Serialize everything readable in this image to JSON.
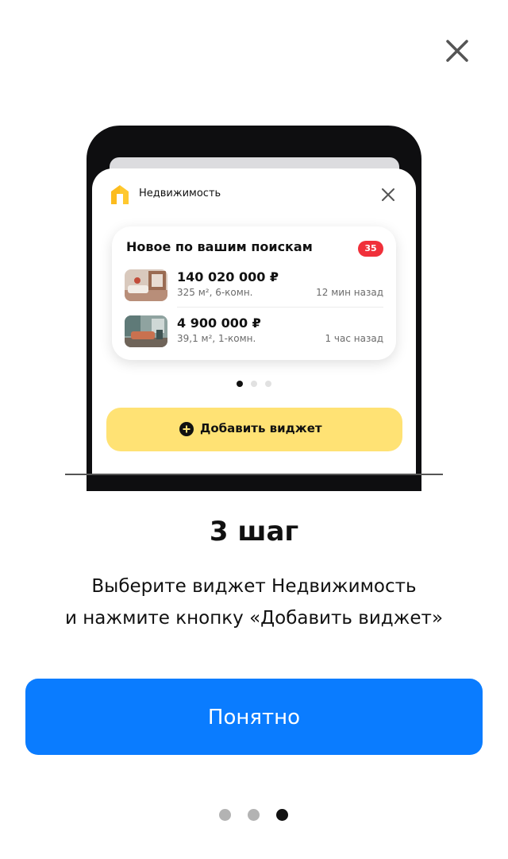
{
  "dialog": {
    "close_icon": "close-icon",
    "step_title": "3 шаг",
    "description_lines": [
      "Выберите виджет Недвижимость",
      "и нажмите кнопку «Добавить виджет»"
    ],
    "primary_button_label": "Понятно",
    "pager": {
      "count": 3,
      "active": 3
    }
  },
  "illustration": {
    "app_name": "Недвижимость",
    "app_icon": "house-icon",
    "close_icon": "close-icon",
    "widget": {
      "title": "Новое по вашим поискам",
      "badge_count": "35",
      "listings": [
        {
          "price": "140 020 000 ₽",
          "specs": "325 м², 6-комн.",
          "time": "12 мин назад"
        },
        {
          "price": "4 900 000 ₽",
          "specs": "39,1 м², 1-комн.",
          "time": "1 час назад"
        }
      ]
    },
    "pager": {
      "count": 3,
      "active": 1
    },
    "add_widget_label": "Добавить виджет",
    "add_widget_icon": "plus-circle-icon"
  },
  "colors": {
    "primary": "#0a7cff",
    "widget_button": "#ffe274",
    "badge": "#f0303a",
    "brand_yellow": "#ffc82e"
  }
}
